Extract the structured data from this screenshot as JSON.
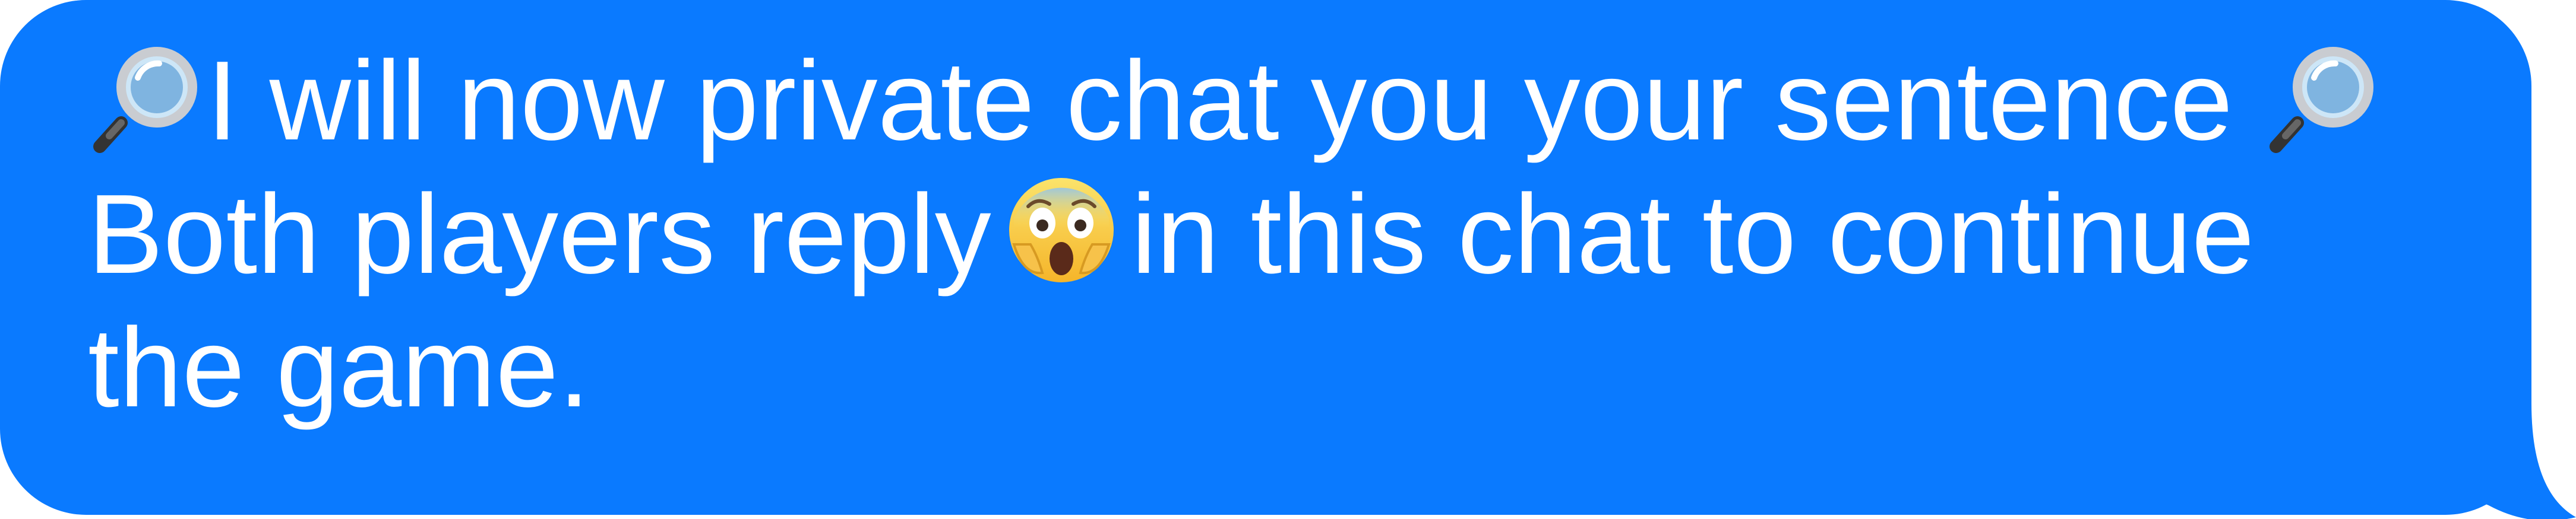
{
  "message": {
    "line1_text": "I will now private chat you your sentence",
    "line2_before": "Both players reply",
    "line2_after": "in this chat to continue",
    "line3_text": "the game.",
    "leading_icon": "magnifying-glass-icon",
    "trailing_icon": "magnifying-glass-icon",
    "inline_icon": "face-screaming-in-fear-icon"
  },
  "colors": {
    "bubble": "#0a7aff",
    "text": "#ffffff"
  }
}
